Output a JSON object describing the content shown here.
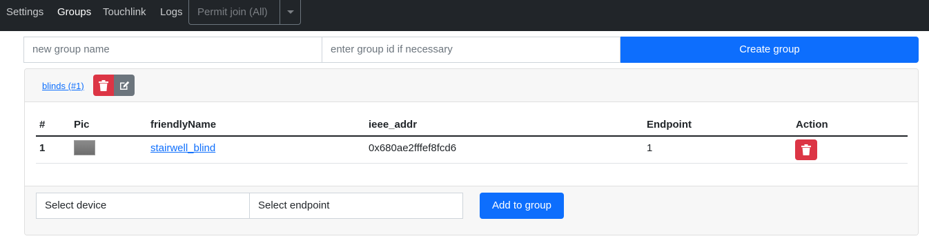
{
  "nav": {
    "items": [
      "Settings",
      "Groups",
      "Touchlink",
      "Logs"
    ],
    "permit_join": "Permit join (All)"
  },
  "create": {
    "name_placeholder": "new group name",
    "id_placeholder": "enter group id if necessary",
    "button": "Create group"
  },
  "group": {
    "title": "blinds (#1)",
    "table": {
      "headers": [
        "#",
        "Pic",
        "friendlyName",
        "ieee_addr",
        "Endpoint",
        "Action"
      ],
      "rows": [
        {
          "index": "1",
          "friendly_name": "stairwell_blind",
          "ieee_addr": "0x680ae2fffef8fcd6",
          "endpoint": "1"
        }
      ]
    },
    "footer": {
      "select_device": "Select device",
      "select_endpoint": "Select endpoint",
      "add_button": "Add to group"
    }
  },
  "colors": {
    "navbar": "#212529",
    "primary": "#0d6efd",
    "danger": "#dc3545",
    "secondary": "#6c757d"
  },
  "icons": {
    "delete": "trash-icon",
    "edit": "edit-icon",
    "dropdown": "caret-down-icon"
  }
}
